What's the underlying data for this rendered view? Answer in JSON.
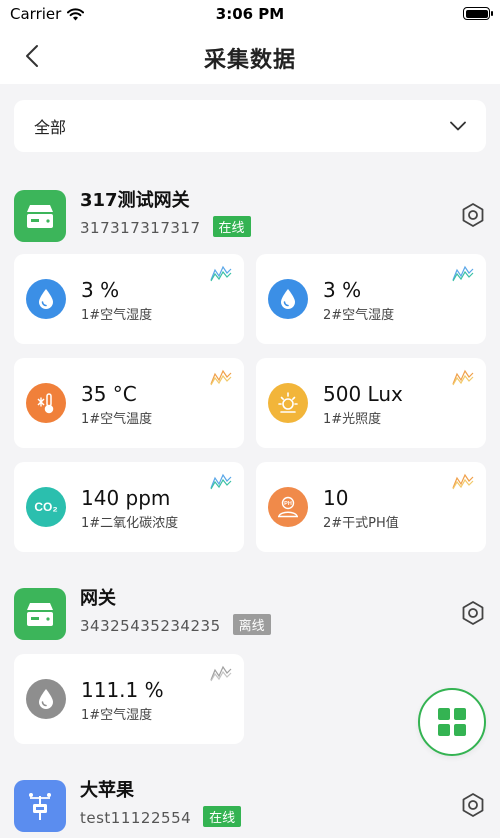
{
  "status_bar": {
    "carrier": "Carrier",
    "time": "3:06 PM"
  },
  "nav": {
    "title": "采集数据"
  },
  "filter": {
    "selected": "全部"
  },
  "colors": {
    "online_badge": "#34b352",
    "offline_badge": "#9c9c9c",
    "gateway_icon_bg": "#3cb55a",
    "device3_icon_bg": "#5b8def",
    "humidity": "#3b8fe6",
    "humidity_offline": "#8e8e8e",
    "temperature": "#f0803a",
    "light": "#f2b53a",
    "co2": "#2bbfae",
    "ph": "#f08a4a",
    "fab_border": "#34b352"
  },
  "devices": [
    {
      "name": "317测试网关",
      "serial": "317317317317",
      "status": "在线",
      "icon": "gateway-icon",
      "sensors": [
        {
          "value": "3 %",
          "label": "1#空气湿度",
          "icon": "humidity-drop-icon"
        },
        {
          "value": "3 %",
          "label": "2#空气湿度",
          "icon": "humidity-drop-icon"
        },
        {
          "value": "35 °C",
          "label": "1#空气温度",
          "icon": "thermometer-icon"
        },
        {
          "value": "500 Lux",
          "label": "1#光照度",
          "icon": "sun-icon"
        },
        {
          "value": "140 ppm",
          "label": "1#二氧化碳浓度",
          "icon": "co2-icon",
          "icon_text": "CO₂"
        },
        {
          "value": "10",
          "label": "2#干式PH值",
          "icon": "ph-icon",
          "icon_text": "PH"
        }
      ]
    },
    {
      "name": "网关",
      "serial": "34325435234235",
      "status": "离线",
      "icon": "gateway-icon",
      "sensors": [
        {
          "value": "111.1 %",
          "label": "1#空气湿度",
          "icon": "humidity-drop-icon"
        }
      ]
    },
    {
      "name": "大苹果",
      "serial": "test11122554",
      "status": "在线",
      "icon": "weather-station-icon"
    }
  ],
  "fab": {
    "icon": "grid-icon"
  }
}
